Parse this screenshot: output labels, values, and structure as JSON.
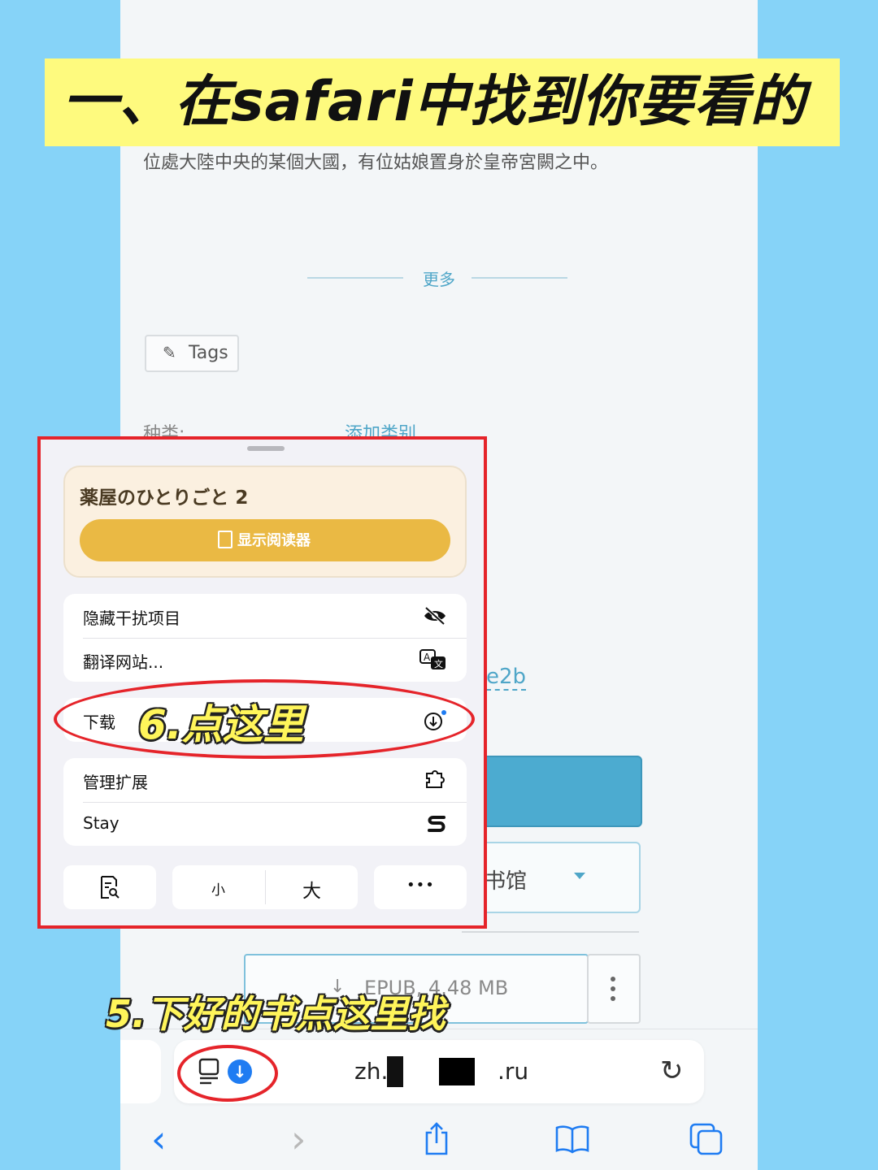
{
  "banner": {
    "text": "一、在safari中找到你要看的"
  },
  "page": {
    "intro_line": "位處大陸中央的某個大國，有位姑娘置身於皇帝宮闕之中。",
    "more_label": "更多",
    "tags_label": "Tags",
    "category_label": "种类:",
    "category_link": "添加类别",
    "partial_link": "e2b",
    "library_select": "书馆",
    "download_format": "EPUB, 4.48 MB"
  },
  "popup": {
    "book_title": "薬屋のひとりごと 2",
    "show_reader_label": "显示阅读器",
    "menu_group_1": [
      {
        "label": "隐藏干扰项目",
        "icon": "eye-slash-icon"
      },
      {
        "label": "翻译网站...",
        "icon": "translate-icon"
      }
    ],
    "download_row": {
      "label": "下载",
      "icon": "download-circle-icon"
    },
    "menu_group_2": [
      {
        "label": "管理扩展",
        "icon": "extensions-icon"
      },
      {
        "label": "Stay",
        "icon": "stay-s-icon"
      }
    ],
    "text_small": "小",
    "text_large": "大",
    "more_glyph": "•••"
  },
  "safari": {
    "url_left": "zh.",
    "url_right": ".ru"
  },
  "annotations": {
    "step6": "6.点这里",
    "step5": "5.下好的书点这里找"
  },
  "colors": {
    "background": "#86d3f8",
    "banner": "#fefa7e",
    "highlight_red": "#e5242a",
    "annotation_yellow": "#fff55a",
    "safari_blue": "#1f7cf2",
    "reader_button": "#eab944"
  }
}
